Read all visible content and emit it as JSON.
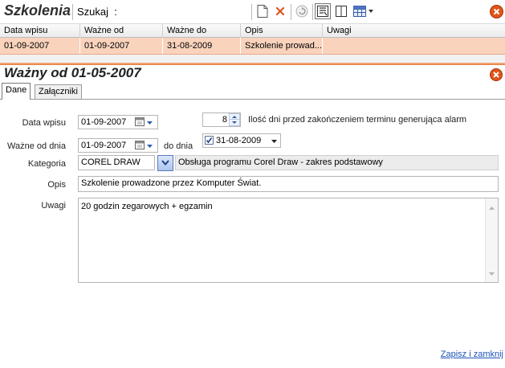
{
  "toolbar": {
    "title": "Szkolenia",
    "search_label": "Szukaj",
    "search_colon": ":",
    "search_value": ""
  },
  "grid": {
    "columns": [
      "Data wpisu",
      "Ważne od",
      "Ważne do",
      "Opis",
      "Uwagi"
    ],
    "rows": [
      {
        "data_wpisu": "01-09-2007",
        "wazne_od": "01-09-2007",
        "wazne_do": "31-08-2009",
        "opis": "Szkolenie prowad...",
        "uwagi": ""
      }
    ]
  },
  "detail": {
    "title": "Ważny od 01-05-2007",
    "tabs": [
      "Dane",
      "Załączniki"
    ],
    "form": {
      "data_wpisu_label": "Data wpisu",
      "data_wpisu_value": "01-09-2007",
      "alarm_days_value": "8",
      "alarm_note": "Ilość dni przed zakończeniem terminu generująca alarm",
      "wazne_od_label": "Ważne od dnia",
      "wazne_od_value": "01-09-2007",
      "do_dnia_label": "do dnia",
      "do_dnia_value": "31-08-2009",
      "kategoria_label": "Kategoria",
      "kategoria_value": "COREL DRAW",
      "kategoria_desc": "Obsługa programu Corel Draw - zakres podstawowy",
      "opis_label": "Opis",
      "opis_value": "Szkolenie prowadzone przez Komputer Świat.",
      "uwagi_label": "Uwagi",
      "uwagi_value": "20 godzin zegarowych + egzamin"
    },
    "save_link": "Zapisz i zamknij"
  },
  "colors": {
    "selected_row": "#fad3bd",
    "splitter": "#e27a3a",
    "link": "#1c52b8",
    "close_icon": "#e0551b"
  }
}
